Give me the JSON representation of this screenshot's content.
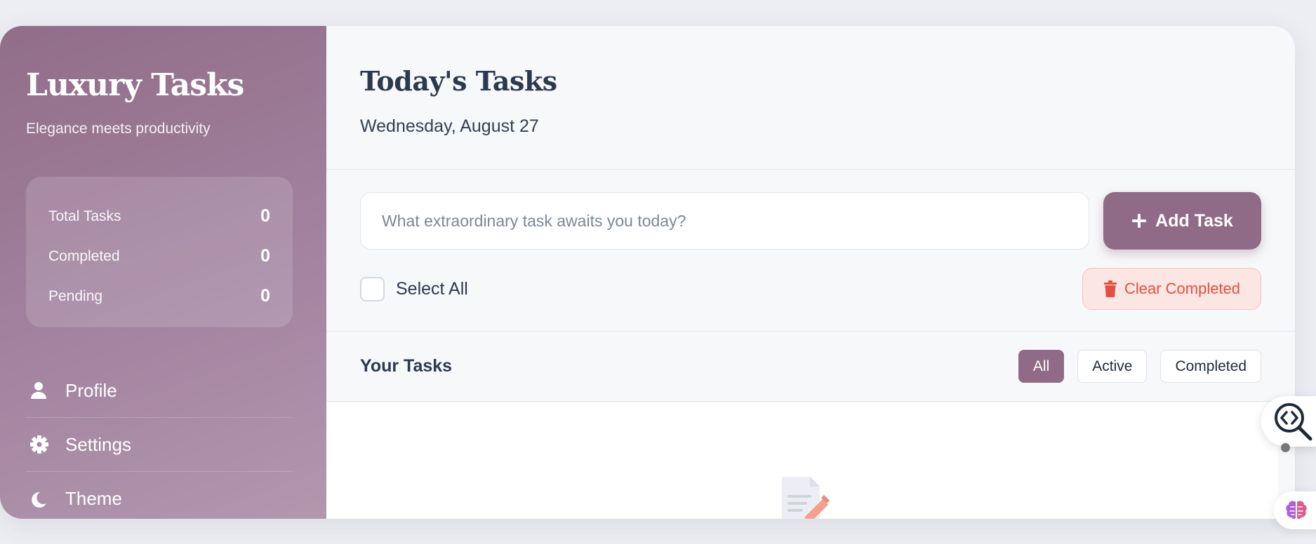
{
  "sidebar": {
    "brand_title": "Luxury Tasks",
    "brand_subtitle": "Elegance meets productivity",
    "stats": [
      {
        "label": "Total Tasks",
        "value": "0"
      },
      {
        "label": "Completed",
        "value": "0"
      },
      {
        "label": "Pending",
        "value": "0"
      }
    ],
    "nav": [
      {
        "label": "Profile",
        "icon": "user-icon"
      },
      {
        "label": "Settings",
        "icon": "gear-icon"
      },
      {
        "label": "Theme",
        "icon": "moon-icon"
      }
    ]
  },
  "header": {
    "title": "Today's Tasks",
    "date": "Wednesday, August 27"
  },
  "composer": {
    "input_placeholder": "What extraordinary task awaits you today?",
    "input_value": "",
    "add_button_label": "Add Task",
    "select_all_label": "Select All",
    "clear_completed_label": "Clear Completed"
  },
  "tasks": {
    "section_title": "Your Tasks",
    "filters": [
      "All",
      "Active",
      "Completed"
    ],
    "active_filter": "All",
    "empty_icon": "document-edit-icon"
  },
  "colors": {
    "accent": "#906b88",
    "danger": "#e4503f",
    "text": "#2c3a4d"
  }
}
